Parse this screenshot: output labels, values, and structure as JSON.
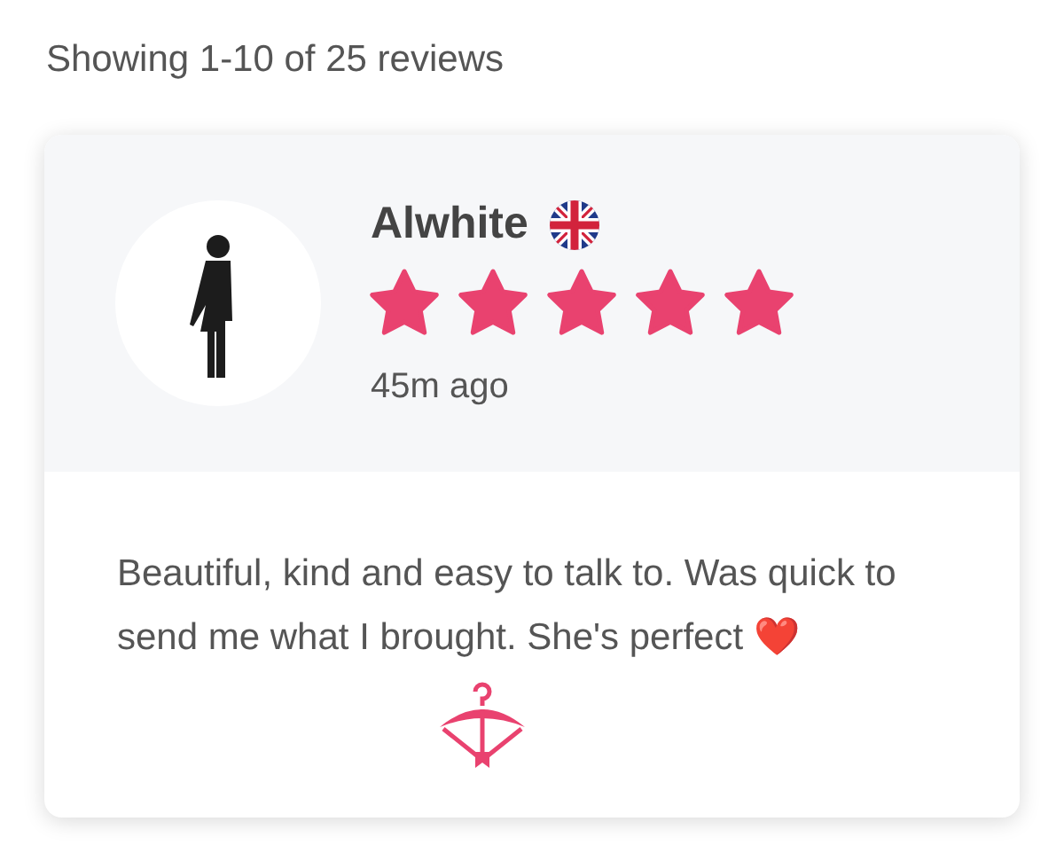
{
  "summary": "Showing 1-10 of 25 reviews",
  "review": {
    "name": "Alwhite",
    "stars": 5,
    "time": "45m ago",
    "text": "Beautiful, kind and easy to talk to. Was quick to send me what I brought. She's perfect ❤️"
  }
}
